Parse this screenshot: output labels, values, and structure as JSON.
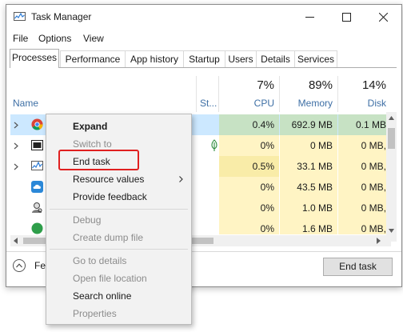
{
  "window": {
    "title": "Task Manager"
  },
  "menubar": [
    "File",
    "Options",
    "View"
  ],
  "tabs": [
    "Processes",
    "Performance",
    "App history",
    "Startup",
    "Users",
    "Details",
    "Services"
  ],
  "active_tab": "Processes",
  "columns": {
    "name": "Name",
    "status": "St...",
    "cpu": {
      "percent": "7%",
      "label": "CPU"
    },
    "memory": {
      "percent": "89%",
      "label": "Memory"
    },
    "disk": {
      "percent": "14%",
      "label": "Disk"
    }
  },
  "rows": [
    {
      "icon": "chrome-icon",
      "expandable": true,
      "status_icon": "",
      "cpu": "0.4%",
      "memory": "692.9 MB",
      "disk": "0.1 MB"
    },
    {
      "icon": "app-window-icon",
      "expandable": true,
      "status_icon": "leaf-icon",
      "cpu": "0%",
      "memory": "0 MB",
      "disk": "0 MB,"
    },
    {
      "icon": "task-manager-icon",
      "expandable": true,
      "status_icon": "",
      "cpu": "0.5%",
      "memory": "33.1 MB",
      "disk": "0 MB,"
    },
    {
      "icon": "cloud-app-icon",
      "expandable": false,
      "status_icon": "",
      "cpu": "0%",
      "memory": "43.5 MB",
      "disk": "0 MB,"
    },
    {
      "icon": "user-search-icon",
      "expandable": false,
      "status_icon": "",
      "cpu": "0%",
      "memory": "1.0 MB",
      "disk": "0 MB,"
    },
    {
      "icon": "green-app-icon",
      "expandable": false,
      "status_icon": "",
      "cpu": "0%",
      "memory": "1.6 MB",
      "disk": "0 MB,"
    }
  ],
  "footer": {
    "fewer_details": "Fe",
    "end_task_button": "End task"
  },
  "context_menu": {
    "items": [
      {
        "label": "Expand",
        "enabled": true,
        "bold": true
      },
      {
        "label": "Switch to",
        "enabled": false
      },
      {
        "label": "End task",
        "enabled": true,
        "highlighted": true
      },
      {
        "label": "Resource values",
        "enabled": true,
        "submenu": true
      },
      {
        "label": "Provide feedback",
        "enabled": true
      },
      {
        "label": "Debug",
        "enabled": false
      },
      {
        "label": "Create dump file",
        "enabled": false
      },
      {
        "label": "Go to details",
        "enabled": false
      },
      {
        "label": "Open file location",
        "enabled": false
      },
      {
        "label": "Search online",
        "enabled": true
      },
      {
        "label": "Properties",
        "enabled": false
      }
    ]
  },
  "colors": {
    "heat_light": "#fff4c4",
    "heat_medium": "#f9eca8",
    "selected_row": "#cce8ff",
    "selected_heat": "#c7e2c4",
    "highlight_box": "#e02020"
  }
}
